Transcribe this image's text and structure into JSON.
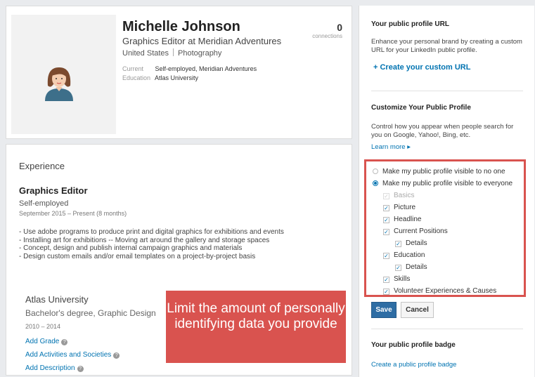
{
  "profile": {
    "name": "Michelle Johnson",
    "headline": "Graphics Editor at Meridian Adventures",
    "location": "United States",
    "industry": "Photography",
    "current_label": "Current",
    "current_value": "Self-employed, Meridian Adventures",
    "education_label": "Education",
    "education_value": "Atlas University",
    "connections_count": "0",
    "connections_label": "connections"
  },
  "experience": {
    "section_title": "Experience",
    "title": "Graphics Editor",
    "company": "Self-employed",
    "dates": "September 2015 – Present (8 months)",
    "description": [
      "- Use adobe programs to produce print and digital graphics for exhibitions and events",
      "- Installing art for exhibitions -- Moving art around the gallery and storage spaces",
      "- Concept, design and publish internal campaign graphics and materials",
      "- Design custom emails and/or email templates on a project-by-project basis"
    ]
  },
  "education": {
    "school": "Atlas University",
    "degree": "Bachelor's degree, Graphic Design",
    "years": "2010 – 2014",
    "links": [
      "Add Grade",
      "Add Activities and Societies",
      "Add Description"
    ]
  },
  "callout": {
    "text": "Limit the amount of personally identifying data you provide"
  },
  "sidebar": {
    "url_heading": "Your public profile URL",
    "url_text": "Enhance your personal brand by creating a custom URL for your LinkedIn public profile.",
    "url_link": "Create your custom URL",
    "customize_heading": "Customize Your Public Profile",
    "customize_text": "Control how you appear when people search for you on Google, Yahoo!, Bing, etc.",
    "learn_more": "Learn more",
    "radio_none": "Make my public profile visible to no one",
    "radio_everyone": "Make my public profile visible to everyone",
    "checks": [
      {
        "label": "Basics",
        "checked": true,
        "disabled": true
      },
      {
        "label": "Picture",
        "checked": true,
        "disabled": false
      },
      {
        "label": "Headline",
        "checked": true,
        "disabled": false
      },
      {
        "label": "Current Positions",
        "checked": true,
        "disabled": false
      },
      {
        "label": "Details",
        "checked": true,
        "disabled": false
      },
      {
        "label": "Education",
        "checked": true,
        "disabled": false
      },
      {
        "label": "Details",
        "checked": true,
        "disabled": false
      },
      {
        "label": "Skills",
        "checked": true,
        "disabled": false
      },
      {
        "label": "Volunteer Experiences & Causes",
        "checked": true,
        "disabled": false
      }
    ],
    "save_label": "Save",
    "cancel_label": "Cancel",
    "badge_heading": "Your public profile badge",
    "badge_link": "Create a public profile badge"
  },
  "colors": {
    "accent": "#0073b1",
    "callout": "#d9534f",
    "save_button": "#2e6da4"
  }
}
